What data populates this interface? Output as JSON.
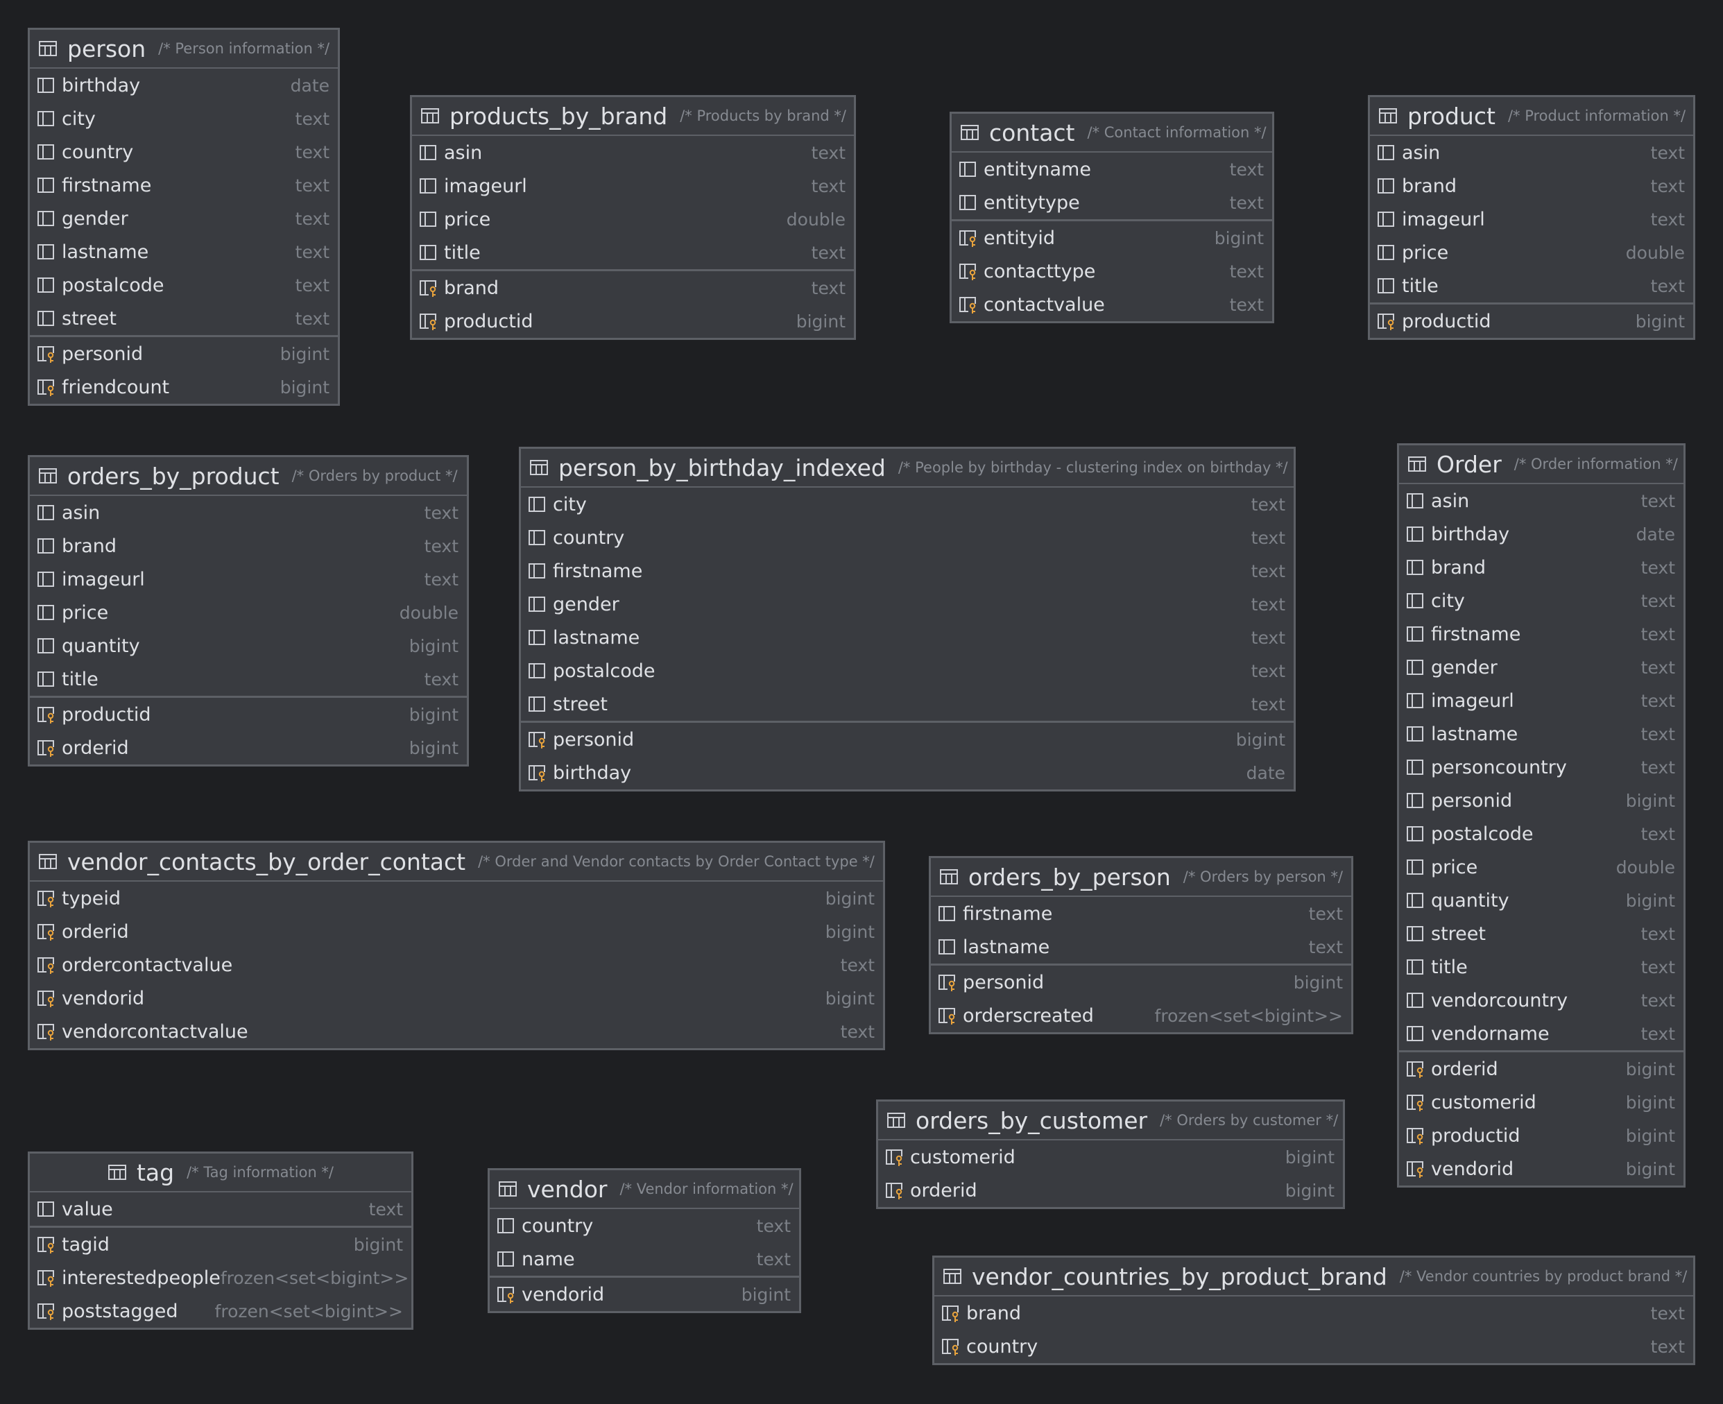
{
  "tables": [
    {
      "name": "person",
      "comment": "/* Person information */",
      "columns": [
        [
          "birthday",
          "date"
        ],
        [
          "city",
          "text"
        ],
        [
          "country",
          "text"
        ],
        [
          "firstname",
          "text"
        ],
        [
          "gender",
          "text"
        ],
        [
          "lastname",
          "text"
        ],
        [
          "postalcode",
          "text"
        ],
        [
          "street",
          "text"
        ]
      ],
      "keys": [
        [
          "personid",
          "bigint"
        ],
        [
          "friendcount",
          "bigint"
        ]
      ]
    },
    {
      "name": "products_by_brand",
      "comment": "/* Products by brand */",
      "columns": [
        [
          "asin",
          "text"
        ],
        [
          "imageurl",
          "text"
        ],
        [
          "price",
          "double"
        ],
        [
          "title",
          "text"
        ]
      ],
      "keys": [
        [
          "brand",
          "text"
        ],
        [
          "productid",
          "bigint"
        ]
      ]
    },
    {
      "name": "contact",
      "comment": "/* Contact information */",
      "columns": [
        [
          "entityname",
          "text"
        ],
        [
          "entitytype",
          "text"
        ]
      ],
      "keys": [
        [
          "entityid",
          "bigint"
        ],
        [
          "contacttype",
          "text"
        ],
        [
          "contactvalue",
          "text"
        ]
      ]
    },
    {
      "name": "product",
      "comment": "/* Product information */",
      "columns": [
        [
          "asin",
          "text"
        ],
        [
          "brand",
          "text"
        ],
        [
          "imageurl",
          "text"
        ],
        [
          "price",
          "double"
        ],
        [
          "title",
          "text"
        ]
      ],
      "keys": [
        [
          "productid",
          "bigint"
        ]
      ]
    },
    {
      "name": "orders_by_product",
      "comment": "/* Orders by product */",
      "columns": [
        [
          "asin",
          "text"
        ],
        [
          "brand",
          "text"
        ],
        [
          "imageurl",
          "text"
        ],
        [
          "price",
          "double"
        ],
        [
          "quantity",
          "bigint"
        ],
        [
          "title",
          "text"
        ]
      ],
      "keys": [
        [
          "productid",
          "bigint"
        ],
        [
          "orderid",
          "bigint"
        ]
      ]
    },
    {
      "name": "person_by_birthday_indexed",
      "comment": "/* People by birthday - clustering index on birthday */",
      "columns": [
        [
          "city",
          "text"
        ],
        [
          "country",
          "text"
        ],
        [
          "firstname",
          "text"
        ],
        [
          "gender",
          "text"
        ],
        [
          "lastname",
          "text"
        ],
        [
          "postalcode",
          "text"
        ],
        [
          "street",
          "text"
        ]
      ],
      "keys": [
        [
          "personid",
          "bigint"
        ],
        [
          "birthday",
          "date"
        ]
      ]
    },
    {
      "name": "Order",
      "comment": "/* Order information */",
      "columns": [
        [
          "asin",
          "text"
        ],
        [
          "birthday",
          "date"
        ],
        [
          "brand",
          "text"
        ],
        [
          "city",
          "text"
        ],
        [
          "firstname",
          "text"
        ],
        [
          "gender",
          "text"
        ],
        [
          "imageurl",
          "text"
        ],
        [
          "lastname",
          "text"
        ],
        [
          "personcountry",
          "text"
        ],
        [
          "personid",
          "bigint"
        ],
        [
          "postalcode",
          "text"
        ],
        [
          "price",
          "double"
        ],
        [
          "quantity",
          "bigint"
        ],
        [
          "street",
          "text"
        ],
        [
          "title",
          "text"
        ],
        [
          "vendorcountry",
          "text"
        ],
        [
          "vendorname",
          "text"
        ]
      ],
      "keys": [
        [
          "orderid",
          "bigint"
        ],
        [
          "customerid",
          "bigint"
        ],
        [
          "productid",
          "bigint"
        ],
        [
          "vendorid",
          "bigint"
        ]
      ]
    },
    {
      "name": "vendor_contacts_by_order_contact",
      "comment": "/* Order and Vendor contacts by Order Contact type */",
      "columns": [],
      "keys": [
        [
          "typeid",
          "bigint"
        ],
        [
          "orderid",
          "bigint"
        ],
        [
          "ordercontactvalue",
          "text"
        ],
        [
          "vendorid",
          "bigint"
        ],
        [
          "vendorcontactvalue",
          "text"
        ]
      ]
    },
    {
      "name": "orders_by_person",
      "comment": "/* Orders by person */",
      "columns": [
        [
          "firstname",
          "text"
        ],
        [
          "lastname",
          "text"
        ]
      ],
      "keys": [
        [
          "personid",
          "bigint"
        ],
        [
          "orderscreated",
          "frozen<set<bigint>>"
        ]
      ]
    },
    {
      "name": "orders_by_customer",
      "comment": "/* Orders by customer */",
      "columns": [],
      "keys": [
        [
          "customerid",
          "bigint"
        ],
        [
          "orderid",
          "bigint"
        ]
      ]
    },
    {
      "name": "tag",
      "comment": "/* Tag information */",
      "columns": [
        [
          "value",
          "text"
        ]
      ],
      "keys": [
        [
          "tagid",
          "bigint"
        ],
        [
          "interestedpeople",
          "frozen<set<bigint>>"
        ],
        [
          "poststagged",
          "frozen<set<bigint>>"
        ]
      ]
    },
    {
      "name": "vendor",
      "comment": "/* Vendor information */",
      "columns": [
        [
          "country",
          "text"
        ],
        [
          "name",
          "text"
        ]
      ],
      "keys": [
        [
          "vendorid",
          "bigint"
        ]
      ]
    },
    {
      "name": "vendor_countries_by_product_brand",
      "comment": "/* Vendor countries by product brand */",
      "columns": [],
      "keys": [
        [
          "brand",
          "text"
        ],
        [
          "country",
          "text"
        ]
      ]
    }
  ],
  "colors": {
    "background": "#1e1f22",
    "panel": "#393b40",
    "border": "#5d6066",
    "key_icon": "#e8a33d"
  },
  "icons": {
    "table": "table-icon",
    "column": "column-icon",
    "key": "key-column-icon"
  }
}
